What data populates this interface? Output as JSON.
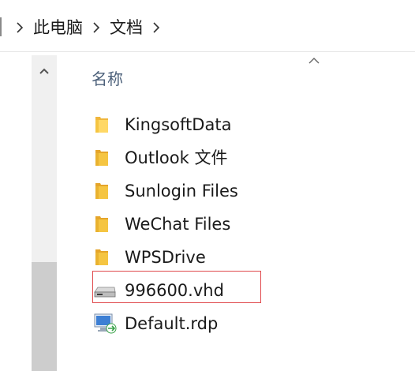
{
  "breadcrumb": {
    "items": [
      {
        "label": "此电脑"
      },
      {
        "label": "文档"
      }
    ]
  },
  "column_header": {
    "name_label": "名称",
    "sort_icon": "chevron-up-icon"
  },
  "files": [
    {
      "name": "KingsoftData",
      "icon": "folder-icon"
    },
    {
      "name": "Outlook 文件",
      "icon": "folder-icon"
    },
    {
      "name": "Sunlogin Files",
      "icon": "folder-icon"
    },
    {
      "name": "WeChat Files",
      "icon": "folder-icon"
    },
    {
      "name": "WPSDrive",
      "icon": "folder-icon"
    },
    {
      "name": "996600.vhd",
      "icon": "virtual-disk-icon",
      "highlighted": true
    },
    {
      "name": "Default.rdp",
      "icon": "remote-desktop-icon"
    }
  ],
  "colors": {
    "highlight_border": "#e0494c",
    "folder_yellow": "#f5c542",
    "header_text": "#4c607a"
  }
}
